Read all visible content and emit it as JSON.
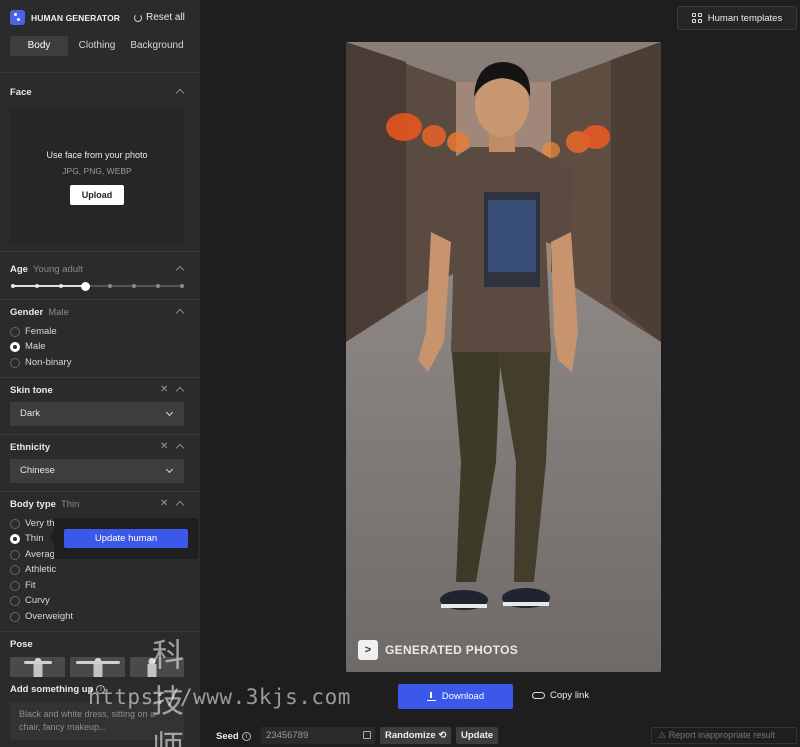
{
  "brand": {
    "name": "HUMAN GENERATOR",
    "reset_label": "Reset all"
  },
  "tabs": [
    {
      "label": "Body",
      "active": true
    },
    {
      "label": "Clothing",
      "active": false
    },
    {
      "label": "Background",
      "active": false
    }
  ],
  "face": {
    "title": "Face",
    "prompt": "Use face from your photo",
    "types": "JPG, PNG, WEBP",
    "upload_label": "Upload"
  },
  "age": {
    "title": "Age",
    "value": "Young adult",
    "step": 3,
    "steps": 8
  },
  "gender": {
    "title": "Gender",
    "value": "Male",
    "options": [
      "Female",
      "Male",
      "Non-binary"
    ],
    "selected": "Male"
  },
  "skin_tone": {
    "title": "Skin tone",
    "value": "Dark"
  },
  "ethnicity": {
    "title": "Ethnicity",
    "value": "Chinese"
  },
  "body_type": {
    "title": "Body type",
    "value": "Thin",
    "options": [
      "Very th",
      "Thin",
      "Averag",
      "Athletic",
      "Fit",
      "Curvy",
      "Overweight"
    ],
    "selected": "Thin",
    "update_label": "Update human"
  },
  "pose": {
    "title": "Pose"
  },
  "add_something": {
    "title": "Add something up",
    "placeholder": "Black and white dress, sitting on a chair, fancy makeup..."
  },
  "header": {
    "templates_label": "Human templates"
  },
  "photo": {
    "watermark": "GENERATED PHOTOS",
    "watermark_logo": ">"
  },
  "actions": {
    "download_label": "Download",
    "copy_link_label": "Copy link"
  },
  "seed": {
    "label": "Seed",
    "value": "23456789",
    "randomize_label": "Randomize",
    "update_label": "Update",
    "report_label": "Report inappropriate result"
  },
  "overlay": {
    "site_name": "科技师",
    "site_url": "https://www.3kjs.com"
  },
  "colors": {
    "accent": "#3b58e8",
    "panel": "#2b2b2b",
    "background": "#1e1e1e"
  }
}
